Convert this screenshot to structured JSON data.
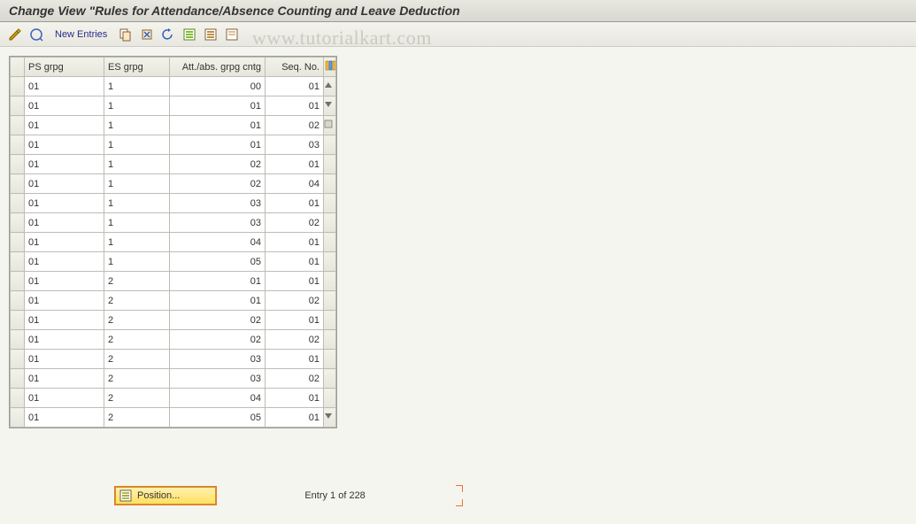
{
  "title": "Change View \"Rules for Attendance/Absence Counting and Leave Deduction",
  "watermark": "www.tutorialkart.com",
  "toolbar": {
    "new_entries": "New Entries"
  },
  "table": {
    "headers": {
      "ps": "PS grpg",
      "es": "ES grpg",
      "at": "Att./abs. grpg cntg",
      "sq": "Seq. No."
    },
    "rows": [
      {
        "ps": "01",
        "es": "1",
        "at": "00",
        "sq": "01"
      },
      {
        "ps": "01",
        "es": "1",
        "at": "01",
        "sq": "01"
      },
      {
        "ps": "01",
        "es": "1",
        "at": "01",
        "sq": "02"
      },
      {
        "ps": "01",
        "es": "1",
        "at": "01",
        "sq": "03"
      },
      {
        "ps": "01",
        "es": "1",
        "at": "02",
        "sq": "01"
      },
      {
        "ps": "01",
        "es": "1",
        "at": "02",
        "sq": "04"
      },
      {
        "ps": "01",
        "es": "1",
        "at": "03",
        "sq": "01"
      },
      {
        "ps": "01",
        "es": "1",
        "at": "03",
        "sq": "02"
      },
      {
        "ps": "01",
        "es": "1",
        "at": "04",
        "sq": "01"
      },
      {
        "ps": "01",
        "es": "1",
        "at": "05",
        "sq": "01"
      },
      {
        "ps": "01",
        "es": "2",
        "at": "01",
        "sq": "01"
      },
      {
        "ps": "01",
        "es": "2",
        "at": "01",
        "sq": "02"
      },
      {
        "ps": "01",
        "es": "2",
        "at": "02",
        "sq": "01"
      },
      {
        "ps": "01",
        "es": "2",
        "at": "02",
        "sq": "02"
      },
      {
        "ps": "01",
        "es": "2",
        "at": "03",
        "sq": "01"
      },
      {
        "ps": "01",
        "es": "2",
        "at": "03",
        "sq": "02"
      },
      {
        "ps": "01",
        "es": "2",
        "at": "04",
        "sq": "01"
      },
      {
        "ps": "01",
        "es": "2",
        "at": "05",
        "sq": "01"
      }
    ]
  },
  "footer": {
    "position_label": "Position...",
    "entry_text": "Entry 1 of 228"
  }
}
